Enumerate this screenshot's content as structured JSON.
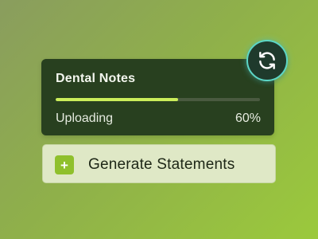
{
  "upload": {
    "title": "Dental Notes",
    "status": "Uploading",
    "percent_label": "60%",
    "progress": 0.6
  },
  "refresh": {
    "icon": "refresh-icon"
  },
  "generate": {
    "icon_glyph": "+",
    "label": "Generate Statements"
  },
  "colors": {
    "card_bg": "#28401f",
    "progress_fill": "#cbee5a",
    "accent_ring": "#5cd6c6",
    "plus_badge": "#8fc02c",
    "button_bg": "#dfe8c6"
  }
}
